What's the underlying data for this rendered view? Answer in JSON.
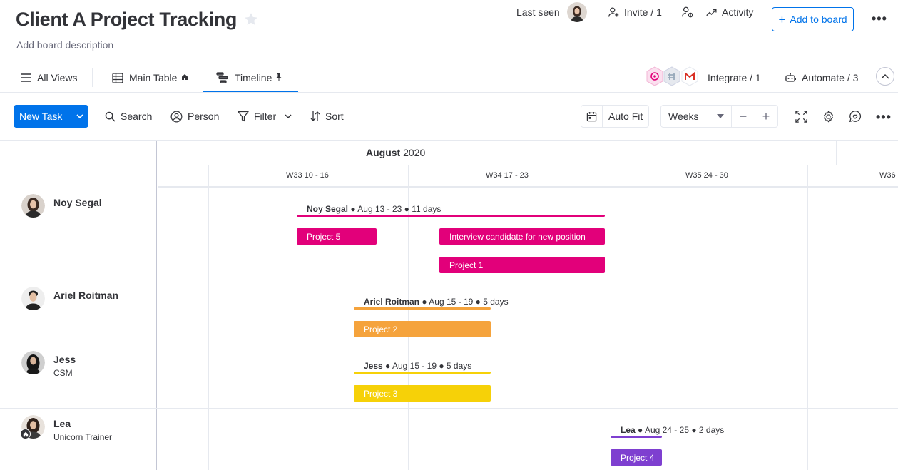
{
  "board": {
    "title": "Client A Project Tracking",
    "description": "Add board description"
  },
  "header": {
    "last_seen": "Last seen",
    "invite": "Invite / 1",
    "activity": "Activity",
    "add_to_board": "Add to board",
    "more": "•••"
  },
  "views": {
    "all_views": "All Views",
    "main_table": "Main Table",
    "timeline": "Timeline",
    "integrate": "Integrate / 1",
    "automate": "Automate / 3"
  },
  "toolbar": {
    "new_task": "New Task",
    "search": "Search",
    "person": "Person",
    "filter": "Filter",
    "sort": "Sort",
    "auto_fit": "Auto Fit",
    "zoom_value": "Weeks",
    "minus": "−",
    "plus": "+",
    "more": "•••"
  },
  "timeline": {
    "month_name": "August",
    "month_year": "2020",
    "weeks": [
      {
        "label": "W33   10 - 16"
      },
      {
        "label": "W34   17 - 23"
      },
      {
        "label": "W35   24 - 30"
      },
      {
        "label": "W36"
      }
    ],
    "groups": [
      {
        "name": "Noy Segal",
        "role": "",
        "summary_name": "Noy Segal",
        "summary_range": " ● Aug 13 - 23 ● 11 days",
        "color": "#e2007a",
        "tasks": [
          "Project 5",
          "Interview candidate for new position",
          "Project 1"
        ]
      },
      {
        "name": "Ariel Roitman",
        "role": "",
        "summary_name": "Ariel Roitman",
        "summary_range": " ● Aug 15 - 19 ● 5 days",
        "color": "#f5a33c",
        "tasks": [
          "Project 2"
        ]
      },
      {
        "name": "Jess",
        "role": "CSM",
        "summary_name": "Jess",
        "summary_range": " ● Aug 15 - 19 ● 5 days",
        "color": "#f6d108",
        "tasks": [
          "Project 3"
        ]
      },
      {
        "name": "Lea",
        "role": "Unicorn Trainer",
        "summary_name": "Lea",
        "summary_range": " ● Aug 24 - 25 ● 2 days",
        "color": "#7e3fd0",
        "tasks": [
          "Project 4"
        ]
      }
    ]
  },
  "colors": {
    "primary": "#0073ea",
    "border": "#e6e9ef",
    "text": "#323338"
  }
}
